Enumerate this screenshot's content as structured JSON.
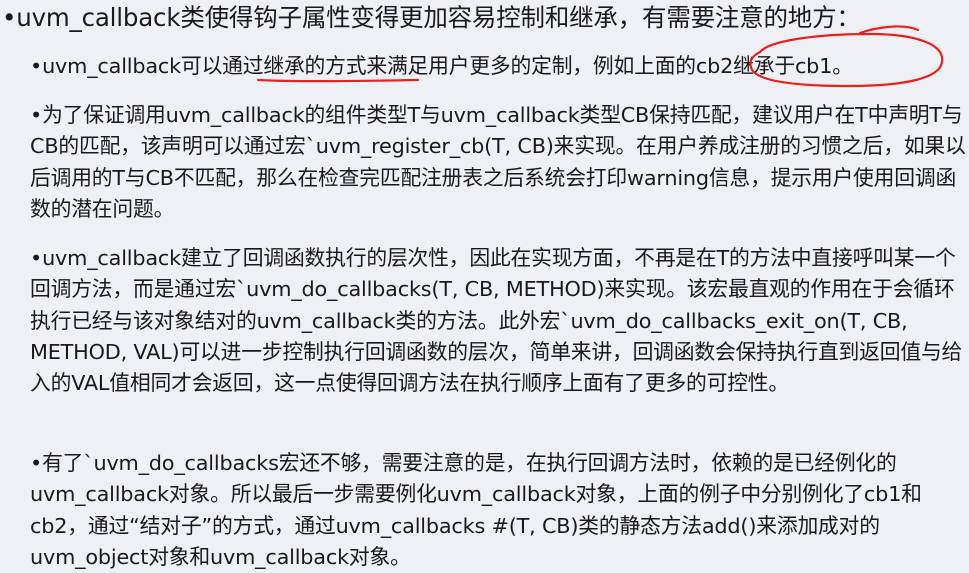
{
  "title": "•uvm_callback类使得钩子属性变得更加容易控制和继承，有需要注意的地方：",
  "bullets": [
    "•uvm_callback可以通过继承的方式来满足用户更多的定制，例如上面的cb2继承于cb1。",
    "•为了保证调用uvm_callback的组件类型T与uvm_callback类型CB保持匹配，建议用户在T中声明T与CB的匹配，该声明可以通过宏`uvm_register_cb(T, CB)来实现。在用户养成注册的习惯之后，如果以后调用的T与CB不匹配，那么在检查完匹配注册表之后系统会打印warning信息，提示用户使用回调函数的潜在问题。",
    "•uvm_callback建立了回调函数执行的层次性，因此在实现方面，不再是在T的方法中直接呼叫某一个回调方法，而是通过宏`uvm_do_callbacks(T, CB, METHOD)来实现。该宏最直观的作用在于会循环执行已经与该对象结对的uvm_callback类的方法。此外宏`uvm_do_callbacks_exit_on(T, CB, METHOD, VAL)可以进一步控制执行回调函数的层次，简单来讲，回调函数会保持执行直到返回值与给入的VAL值相同才会返回，这一点使得回调方法在执行顺序上面有了更多的可控性。",
    "•有了`uvm_do_callbacks宏还不够，需要注意的是，在执行回调方法时，依赖的是已经例化的uvm_callback对象。所以最后一步需要例化uvm_callback对象，上面的例子中分别例化了cb1和cb2，通过“结对子”的方式，通过uvm_callbacks #(T, CB)类的静态方法add()来添加成对的uvm_object对象和uvm_callback对象。"
  ],
  "colors": {
    "background": "#eef0f6",
    "text": "#1a1a1a",
    "annotation": "#e8211c"
  }
}
